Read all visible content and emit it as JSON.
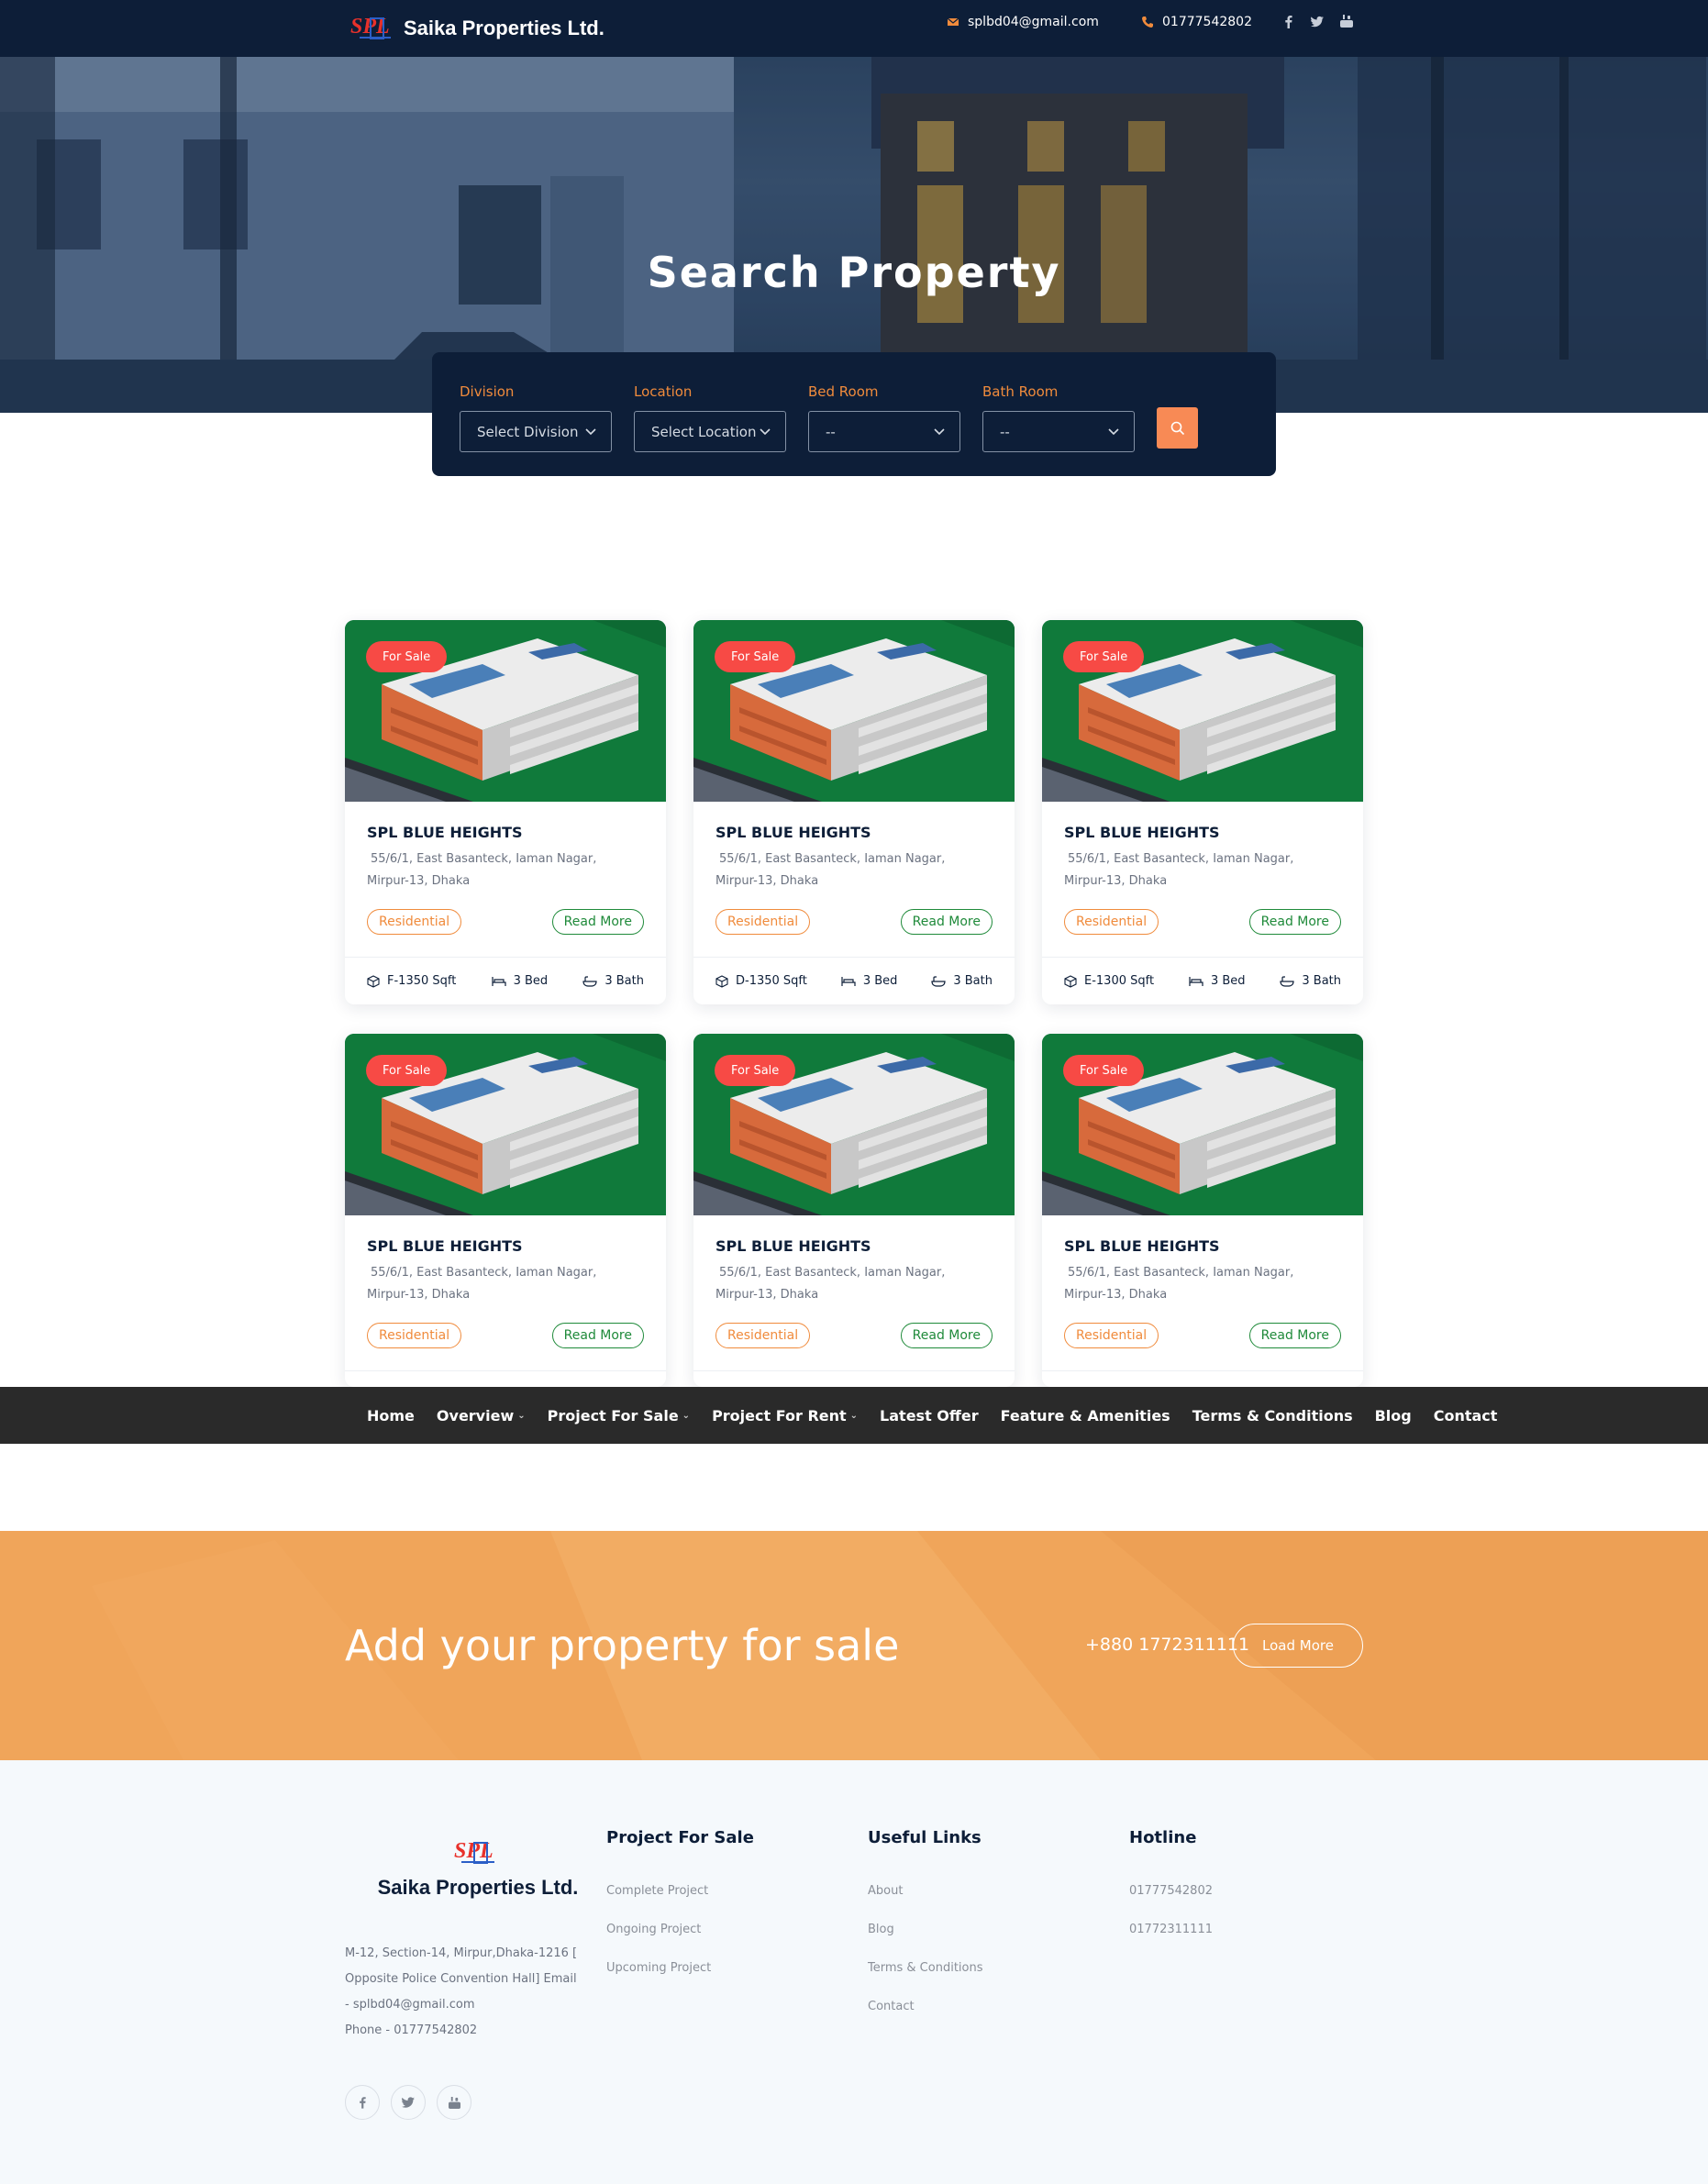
{
  "brand": {
    "name": "Saika Properties Ltd.",
    "logo_letters": "SPL"
  },
  "topbar": {
    "email": "splbd04@gmail.com",
    "phone": "01777542802"
  },
  "hero": {
    "title": "Search Property"
  },
  "search": {
    "fields": [
      {
        "label": "Division",
        "value": "Select Division"
      },
      {
        "label": "Location",
        "value": "Select Location"
      },
      {
        "label": "Bed Room",
        "value": "--"
      },
      {
        "label": "Bath Room",
        "value": "--"
      }
    ]
  },
  "listings": [
    {
      "tag": "For Sale",
      "title": "SPL BLUE HEIGHTS",
      "addr1": "55/6/1, East Basanteck, Iaman Nagar,",
      "addr2": "Mirpur-13, Dhaka",
      "type": "Residential",
      "cta": "Read More",
      "size": "F-1350 Sqft",
      "bed": "3 Bed",
      "bath": "3 Bath"
    },
    {
      "tag": "For Sale",
      "title": "SPL BLUE HEIGHTS",
      "addr1": "55/6/1, East Basanteck, Iaman Nagar,",
      "addr2": "Mirpur-13, Dhaka",
      "type": "Residential",
      "cta": "Read More",
      "size": "D-1350 Sqft",
      "bed": "3 Bed",
      "bath": "3 Bath"
    },
    {
      "tag": "For Sale",
      "title": "SPL BLUE HEIGHTS",
      "addr1": "55/6/1, East Basanteck, Iaman Nagar,",
      "addr2": "Mirpur-13, Dhaka",
      "type": "Residential",
      "cta": "Read More",
      "size": "E-1300 Sqft",
      "bed": "3 Bed",
      "bath": "3 Bath"
    },
    {
      "tag": "For Sale",
      "title": "SPL BLUE HEIGHTS",
      "addr1": "55/6/1, East Basanteck, Iaman Nagar,",
      "addr2": "Mirpur-13, Dhaka",
      "type": "Residential",
      "cta": "Read More"
    },
    {
      "tag": "For Sale",
      "title": "SPL BLUE HEIGHTS",
      "addr1": "55/6/1, East Basanteck, Iaman Nagar,",
      "addr2": "Mirpur-13, Dhaka",
      "type": "Residential",
      "cta": "Read More"
    },
    {
      "tag": "For Sale",
      "title": "SPL BLUE HEIGHTS",
      "addr1": "55/6/1, East Basanteck, Iaman Nagar,",
      "addr2": "Mirpur-13, Dhaka",
      "type": "Residential",
      "cta": "Read More"
    }
  ],
  "nav": [
    "Home",
    "Overview",
    "Project For Sale",
    "Project For Rent",
    "Latest Offer",
    "Feature & Amenities",
    "Terms & Conditions",
    "Blog",
    "Contact"
  ],
  "cta": {
    "text": "Add your property for sale",
    "phone": "+880 1772311111",
    "button": "Load More"
  },
  "footer": {
    "address_lines": [
      "M-12, Section-14, Mirpur,Dhaka-1216 [",
      "Opposite Police Convention Hall] Email",
      "- splbd04@gmail.com",
      "Phone - 01777542802"
    ],
    "cols": [
      {
        "heading": "Project For Sale",
        "links": [
          "Complete Project",
          "Ongoing Project",
          "Upcoming Project"
        ]
      },
      {
        "heading": "Useful Links",
        "links": [
          "About",
          "Blog",
          "Terms & Conditions",
          "Contact"
        ]
      },
      {
        "heading": "Hotline",
        "links": [
          "01777542802",
          "01772311111"
        ]
      }
    ]
  },
  "colors": {
    "navy": "#0d1e38",
    "orange": "#f08b3c",
    "search_btn": "#f88a55",
    "tag_red": "#f74a45",
    "green": "#1f8a3a",
    "cta_bg": "#f0a55a"
  }
}
